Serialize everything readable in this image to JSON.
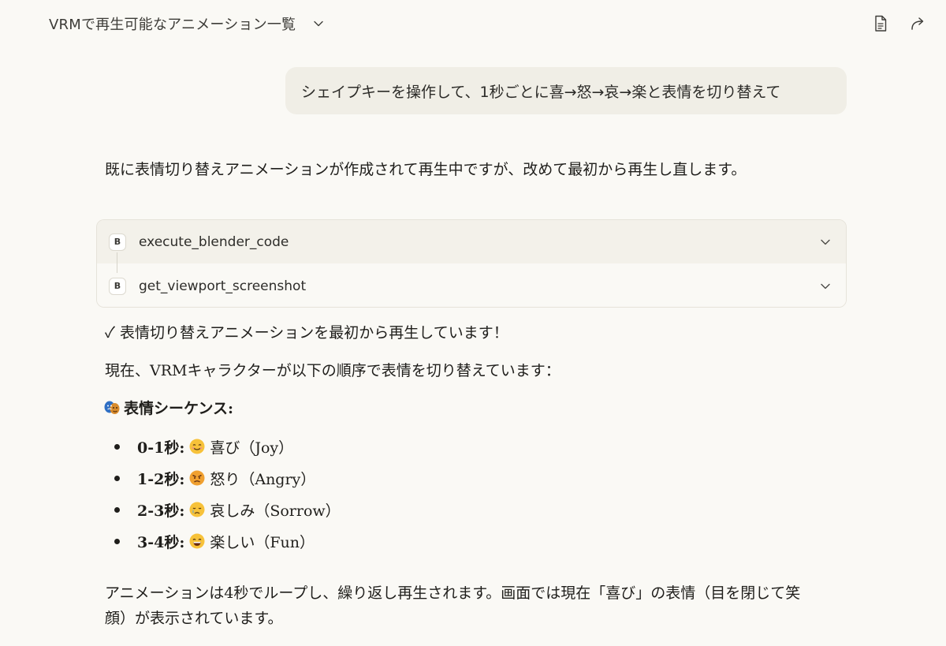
{
  "header": {
    "title": "VRMで再生可能なアニメーション一覧",
    "icons": [
      "chevron-down-icon",
      "document-icon",
      "share-icon"
    ]
  },
  "user_message": {
    "text": "シェイプキーを操作して、1秒ごとに喜→怒→哀→楽と表情を切り替えて"
  },
  "assistant": {
    "intro": "既に表情切り替えアニメーションが作成されて再生中ですが、改めて最初から再生し直します。",
    "tools": [
      {
        "badge": "B",
        "name": "execute_blender_code"
      },
      {
        "badge": "B",
        "name": "get_viewport_screenshot"
      }
    ],
    "check_line": "✓ 表情切り替えアニメーションを最初から再生しています！",
    "status_line": "現在、VRMキャラクターが以下の順序で表情を切り替えています：",
    "sequence_heading": "表情シーケンス:",
    "sequence": [
      {
        "time": "0-1秒:",
        "emoji": "smiling-face-icon",
        "label": "喜び（Joy）"
      },
      {
        "time": "1-2秒:",
        "emoji": "angry-face-icon",
        "label": "怒り（Angry）"
      },
      {
        "time": "2-3秒:",
        "emoji": "crying-face-icon",
        "label": "哀しみ（Sorrow）"
      },
      {
        "time": "3-4秒:",
        "emoji": "grinning-face-icon",
        "label": "楽しい（Fun）"
      }
    ],
    "closing": "アニメーションは4秒でループし、繰り返し再生されます。画面では現在「喜び」の表情（目を閉じて笑顔）が表示されています。"
  },
  "colors": {
    "background": "#faf9f5",
    "bubble": "#f0eee6",
    "tool_row_active": "#f3f1ea",
    "border": "#e6e3da"
  }
}
